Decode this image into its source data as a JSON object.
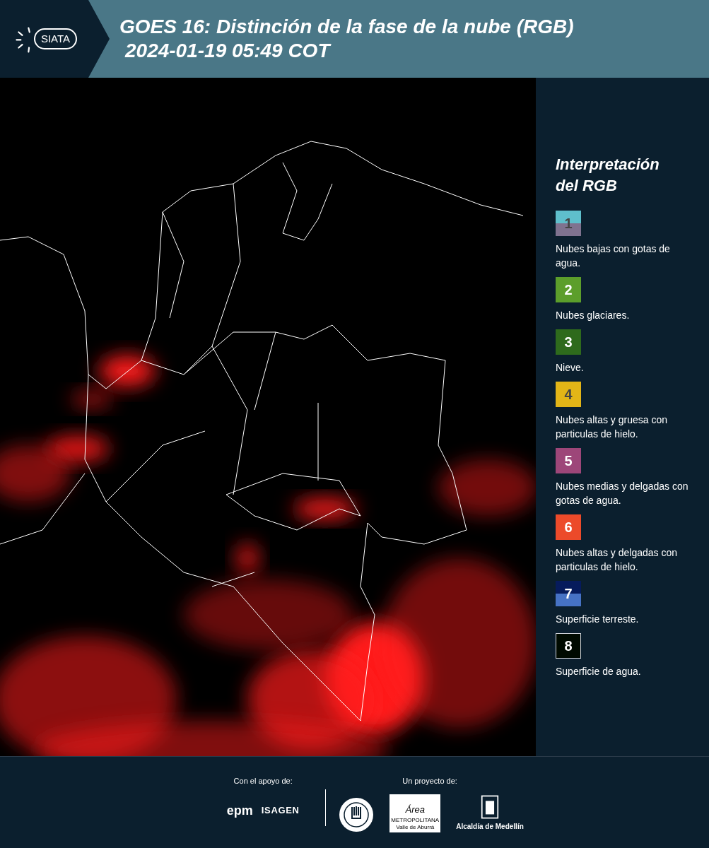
{
  "header": {
    "logo_text": "SIATA",
    "title": "GOES 16: Distinción de la fase de la nube (RGB)",
    "subtitle": "2024-01-19 05:49 COT"
  },
  "legend": {
    "title": "Interpretación del RGB",
    "items": [
      {
        "number": "1",
        "bands": [
          {
            "color": "#5fbfcc"
          },
          {
            "color": "#7f728f"
          }
        ],
        "label": "Nubes bajas con gotas de agua."
      },
      {
        "number": "2",
        "bands": [
          {
            "color": "#5c9e2b"
          }
        ],
        "label": "Nubes glaciares."
      },
      {
        "number": "3",
        "bands": [
          {
            "color": "#2e6a1c"
          }
        ],
        "label": "Nieve."
      },
      {
        "number": "4",
        "bands": [
          {
            "color": "#e3b517"
          }
        ],
        "label": "Nubes altas y gruesa con particulas de hielo."
      },
      {
        "number": "5",
        "bands": [
          {
            "color": "#9d4679"
          }
        ],
        "label": "Nubes medias y delgadas con gotas de agua."
      },
      {
        "number": "6",
        "bands": [
          {
            "color": "#ec4a2a"
          }
        ],
        "label": "Nubes altas y delgadas con particulas de hielo."
      },
      {
        "number": "7",
        "bands": [
          {
            "color": "#061b5c"
          },
          {
            "color": "#4672c4"
          }
        ],
        "label": "Superficie terreste."
      },
      {
        "number": "8",
        "bands": [
          {
            "color": "#000a00"
          }
        ],
        "label": "Superficie de agua."
      }
    ]
  },
  "footer": {
    "support_label": "Con el apoyo de:",
    "support_logos": [
      "epm",
      "ISAGEN"
    ],
    "project_label": "Un proyecto de:",
    "area_logo": {
      "script": "Área",
      "line_1": "METROPOLITANA",
      "line_2": "Valle de Aburrá"
    },
    "city_logo": "Alcaldía de Medellín"
  }
}
